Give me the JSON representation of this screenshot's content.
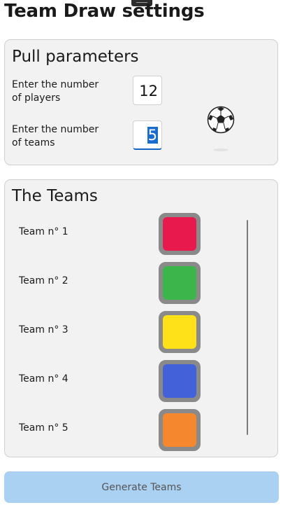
{
  "page": {
    "title": "Team Draw settings"
  },
  "params": {
    "title": "Pull parameters",
    "players_label_line1": "Enter the number",
    "players_label_line2": "of players",
    "players_value": "12",
    "teams_label_line1": "Enter the number",
    "teams_label_line2": "of teams",
    "teams_value": "5",
    "icon": "soccer-ball-icon"
  },
  "teams": {
    "title": "The Teams",
    "items": [
      {
        "label": "Team n° 1",
        "color": "#e8194c"
      },
      {
        "label": "Team n° 2",
        "color": "#3cb54a"
      },
      {
        "label": "Team n° 3",
        "color": "#ffe11a"
      },
      {
        "label": "Team n° 4",
        "color": "#4361d8"
      },
      {
        "label": "Team n° 5",
        "color": "#f5872e"
      }
    ]
  },
  "actions": {
    "generate_label": "Generate Teams"
  },
  "colors": {
    "accent": "#1565c0",
    "button_bg": "#aad0f2",
    "panel_bg": "#f2f2f2"
  }
}
